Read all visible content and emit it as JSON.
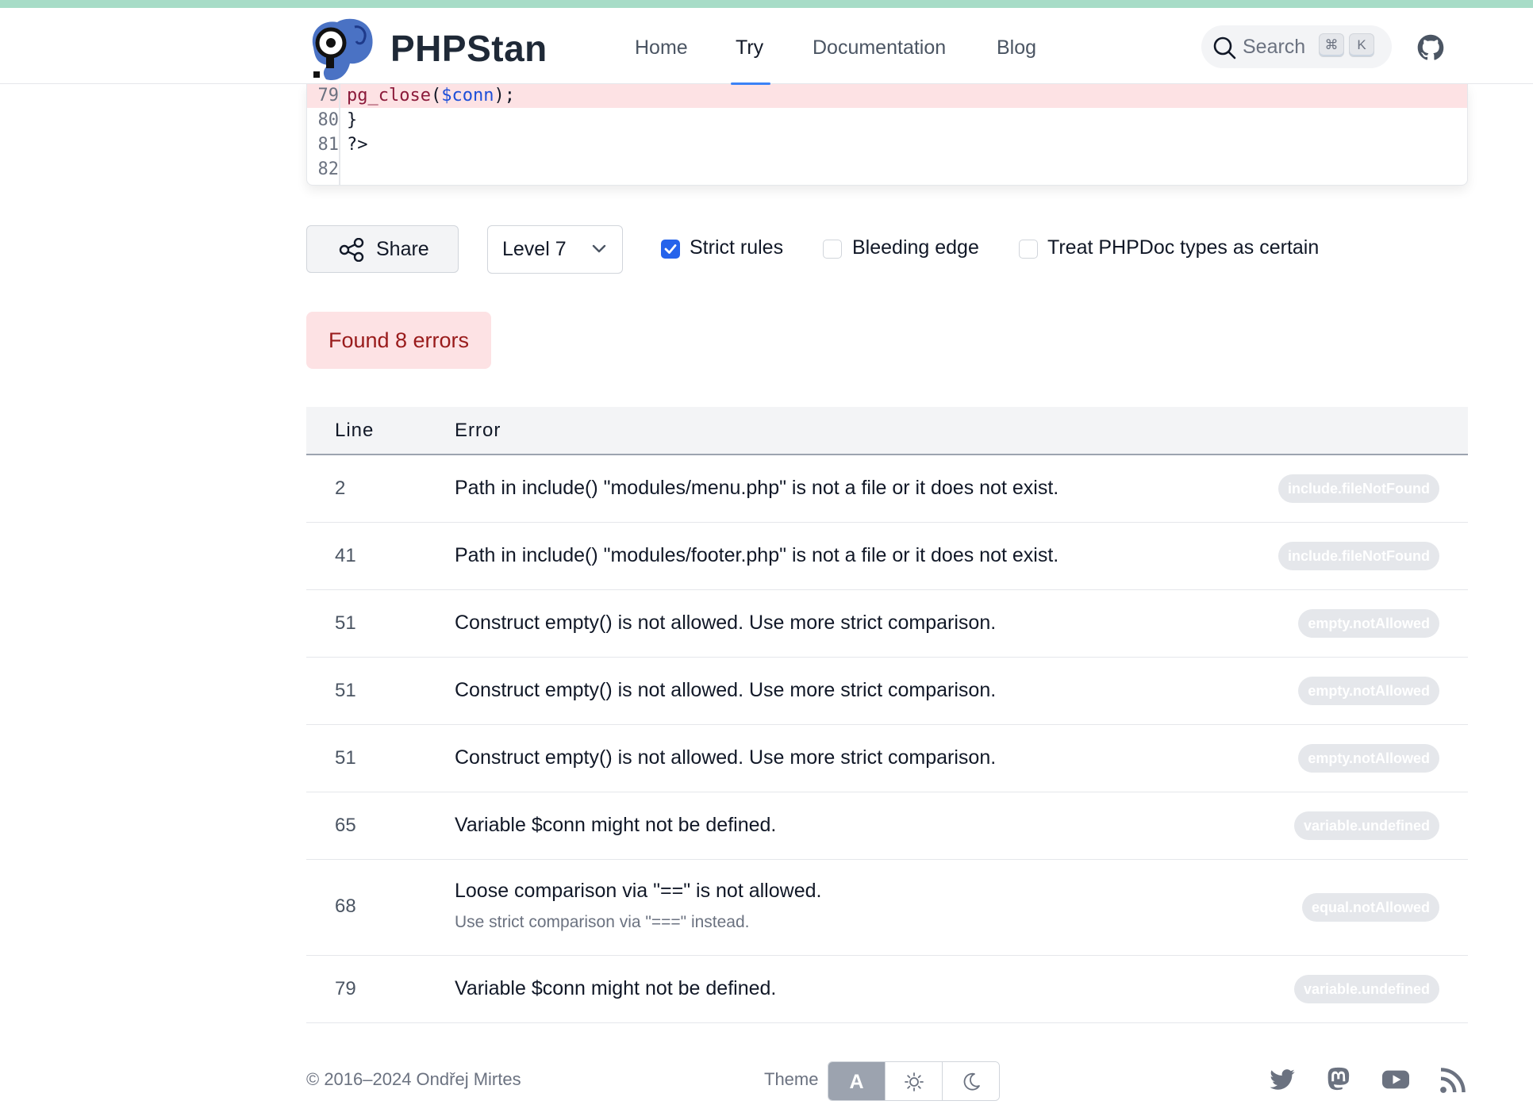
{
  "header": {
    "brand": "PHPStan",
    "nav": [
      {
        "label": "Home"
      },
      {
        "label": "Try"
      },
      {
        "label": "Documentation"
      },
      {
        "label": "Blog"
      }
    ],
    "search": {
      "label": "Search",
      "kbd1": "⌘",
      "kbd2": "K"
    }
  },
  "code": {
    "lines": [
      {
        "num": "79",
        "fn": "pg_close",
        "open": "(",
        "var": "$conn",
        "close": ");",
        "highlight": true
      },
      {
        "num": "80",
        "text": "}"
      },
      {
        "num": "81",
        "text": "?>"
      },
      {
        "num": "82",
        "text": ""
      }
    ]
  },
  "controls": {
    "share_label": "Share",
    "level": "Level 7",
    "strict_rules": {
      "label": "Strict rules",
      "checked": true
    },
    "bleeding_edge": {
      "label": "Bleeding edge",
      "checked": false
    },
    "treat_phpdoc": {
      "label": "Treat PHPDoc types as certain",
      "checked": false
    }
  },
  "result": {
    "summary": "Found 8 errors"
  },
  "table": {
    "headers": {
      "line": "Line",
      "error": "Error"
    },
    "rows": [
      {
        "line": "2",
        "message": "Path in include() \"modules/menu.php\" is not a file or it does not exist.",
        "identifier": "include.fileNotFound"
      },
      {
        "line": "41",
        "message": "Path in include() \"modules/footer.php\" is not a file or it does not exist.",
        "identifier": "include.fileNotFound"
      },
      {
        "line": "51",
        "message": "Construct empty() is not allowed. Use more strict comparison.",
        "identifier": "empty.notAllowed"
      },
      {
        "line": "51",
        "message": "Construct empty() is not allowed. Use more strict comparison.",
        "identifier": "empty.notAllowed"
      },
      {
        "line": "51",
        "message": "Construct empty() is not allowed. Use more strict comparison.",
        "identifier": "empty.notAllowed"
      },
      {
        "line": "65",
        "message": "Variable $conn might not be defined.",
        "identifier": "variable.undefined"
      },
      {
        "line": "68",
        "message": "Loose comparison via \"==\" is not allowed.",
        "tip": "Use strict comparison via \"===\" instead.",
        "identifier": "equal.notAllowed"
      },
      {
        "line": "79",
        "message": "Variable $conn might not be defined.",
        "identifier": "variable.undefined"
      }
    ]
  },
  "footer": {
    "copyright": "© 2016–2024 Ondřej Mirtes",
    "theme_label": "Theme",
    "theme_auto": "A"
  },
  "colors": {
    "accent": "#2563eb",
    "error_bg": "#fde2e4",
    "error_text": "#991b1b"
  }
}
